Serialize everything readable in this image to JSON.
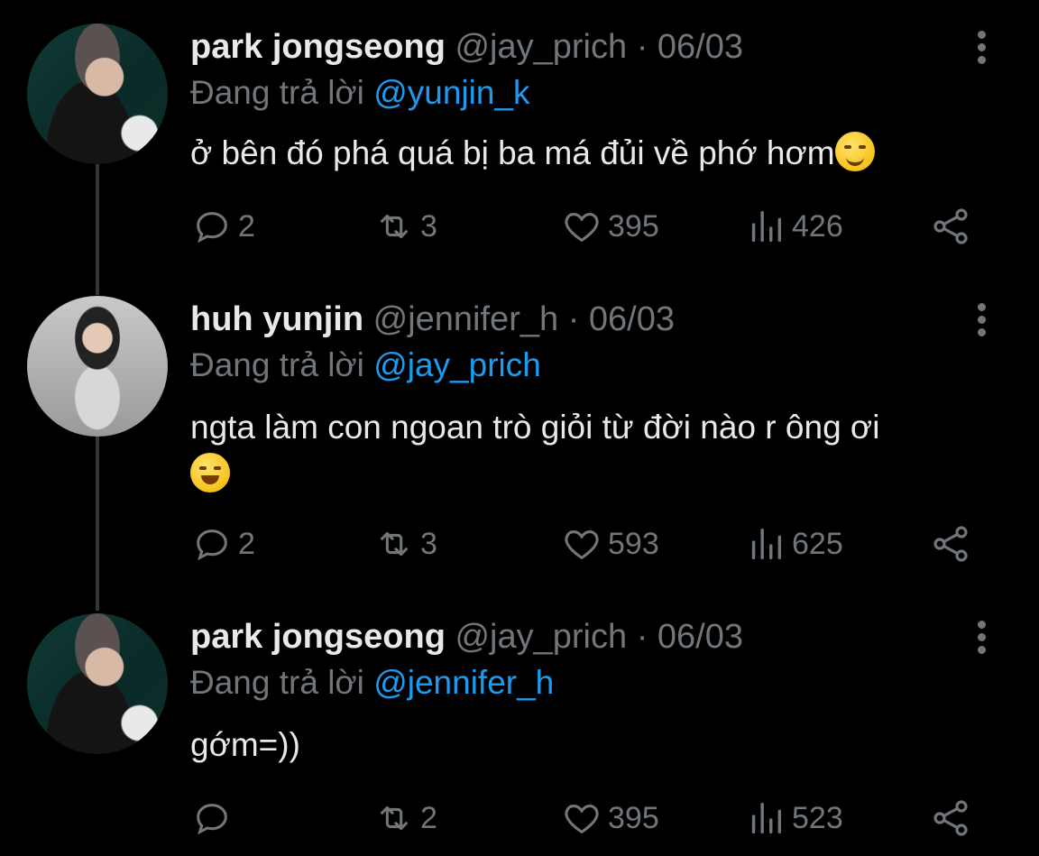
{
  "tweets": [
    {
      "name": "park jongseong",
      "handle": "@jay_prich",
      "date": "· 06/03",
      "replying_prefix": "Đang trả lời",
      "replying_to": "@yunjin_k",
      "text": "ở bên đó phá quá bị ba má đủi về phớ hơm",
      "emoji": "smirk",
      "replies": "2",
      "retweets": "3",
      "likes": "395",
      "views": "426"
    },
    {
      "name": "huh yunjin",
      "handle": "@jennifer_h",
      "date": "· 06/03",
      "replying_prefix": "Đang trả lời",
      "replying_to": "@jay_prich",
      "text": "ngta làm con ngoan trò giỏi từ đời nào r ông ơi",
      "emoji": "sweat-smile",
      "replies": "2",
      "retweets": "3",
      "likes": "593",
      "views": "625"
    },
    {
      "name": "park jongseong",
      "handle": "@jay_prich",
      "date": "· 06/03",
      "replying_prefix": "Đang trả lời",
      "replying_to": "@jennifer_h",
      "text": "gớm=))",
      "replies": "",
      "retweets": "2",
      "likes": "395",
      "views": "523"
    }
  ],
  "icons": {
    "reply": "reply-icon",
    "retweet": "retweet-icon",
    "like": "heart-icon",
    "views": "views-icon",
    "share": "share-icon",
    "more": "more-vertical-icon"
  },
  "colors": {
    "background": "#000000",
    "text": "#e7e9ea",
    "muted": "#71767b",
    "accent": "#1d9bf0"
  }
}
